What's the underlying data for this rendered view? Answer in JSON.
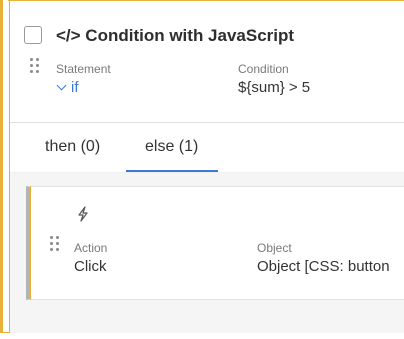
{
  "step": {
    "title": "</> Condition with JavaScript",
    "statement_label": "Statement",
    "statement_value": "if",
    "condition_label": "Condition",
    "condition_value": "${sum} > 5"
  },
  "tabs": [
    {
      "label": "then (0)",
      "active": false
    },
    {
      "label": "else (1)",
      "active": true
    }
  ],
  "else_items": [
    {
      "icon": "bolt-icon",
      "action_label": "Action",
      "action_value": "Click",
      "object_label": "Object",
      "object_value": "Object [CSS: button"
    }
  ],
  "colors": {
    "accent": "#e8b23a",
    "link": "#3d7ad6",
    "tab_underline": "#3d7ad6"
  }
}
